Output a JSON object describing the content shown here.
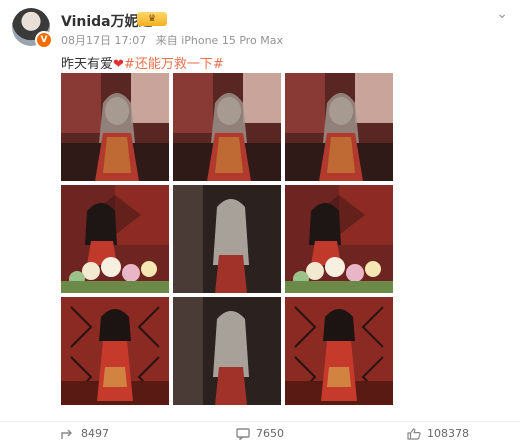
{
  "user": {
    "name": "Vinida万妮达",
    "verified_badge": "V"
  },
  "post": {
    "date": "08月17日 17:07",
    "source": "来自 iPhone 15 Pro Max",
    "text": "昨天有爱",
    "hashtag": "#还能万救一下#"
  },
  "photos": [
    {
      "label": "photo-1",
      "scene": "red-room"
    },
    {
      "label": "photo-2",
      "scene": "red-room"
    },
    {
      "label": "photo-3",
      "scene": "red-room"
    },
    {
      "label": "photo-4",
      "scene": "flowers"
    },
    {
      "label": "photo-5",
      "scene": "dark"
    },
    {
      "label": "photo-6",
      "scene": "flowers"
    },
    {
      "label": "photo-7",
      "scene": "rug"
    },
    {
      "label": "photo-8",
      "scene": "dark"
    },
    {
      "label": "photo-9",
      "scene": "rug"
    }
  ],
  "stats": {
    "reposts": "8497",
    "comments": "7650",
    "likes": "108378"
  },
  "colors": {
    "accent": "#eb7350",
    "heart": "#e0322f",
    "verified": "#f56d00"
  },
  "icons": [
    "more-icon",
    "heart-icon",
    "repost-icon",
    "comment-icon",
    "like-icon"
  ]
}
